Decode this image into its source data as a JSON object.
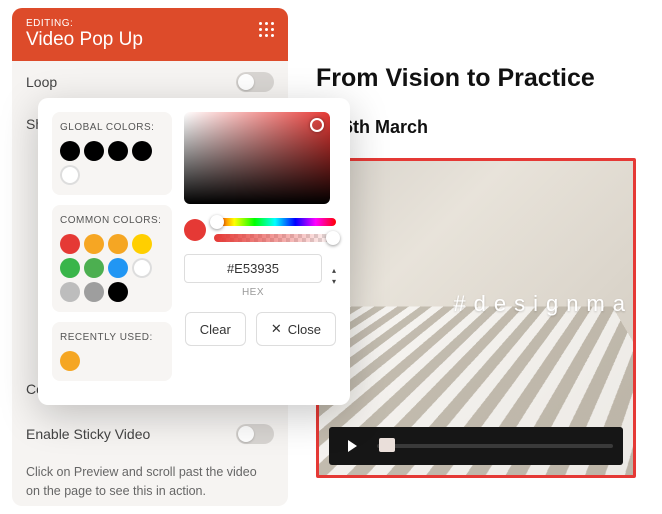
{
  "sidebar": {
    "editing_label": "EDITING:",
    "title": "Video Pop Up",
    "settings": {
      "loop_label": "Loop",
      "show_controls_label": "Show Player Controls",
      "controls_color_label": "Controls Color",
      "enable_sticky_label": "Enable Sticky Video"
    },
    "help_text": "Click on Preview and scroll past the video on the page to see this in action."
  },
  "preview": {
    "heading": "From Vision to Practice",
    "date": "d-26th March",
    "hashtag": "#designma"
  },
  "color_picker": {
    "global_label": "GLOBAL COLORS:",
    "common_label": "COMMON COLORS:",
    "recent_label": "RECENTLY USED:",
    "global_colors": [
      "#000000",
      "#000000",
      "#000000",
      "#000000"
    ],
    "common_colors": [
      "#e53935",
      "#f6a623",
      "#f5a623",
      "#ffcf00",
      "#39b54a",
      "#4caf50",
      "#2196f3",
      "#ffffff",
      "#bdbdbd",
      "#9e9e9e",
      "#000000"
    ],
    "recent_colors": [
      "#f5a623"
    ],
    "hex_value": "#E53935",
    "hex_label": "HEX",
    "clear_label": "Clear",
    "close_label": "Close"
  }
}
